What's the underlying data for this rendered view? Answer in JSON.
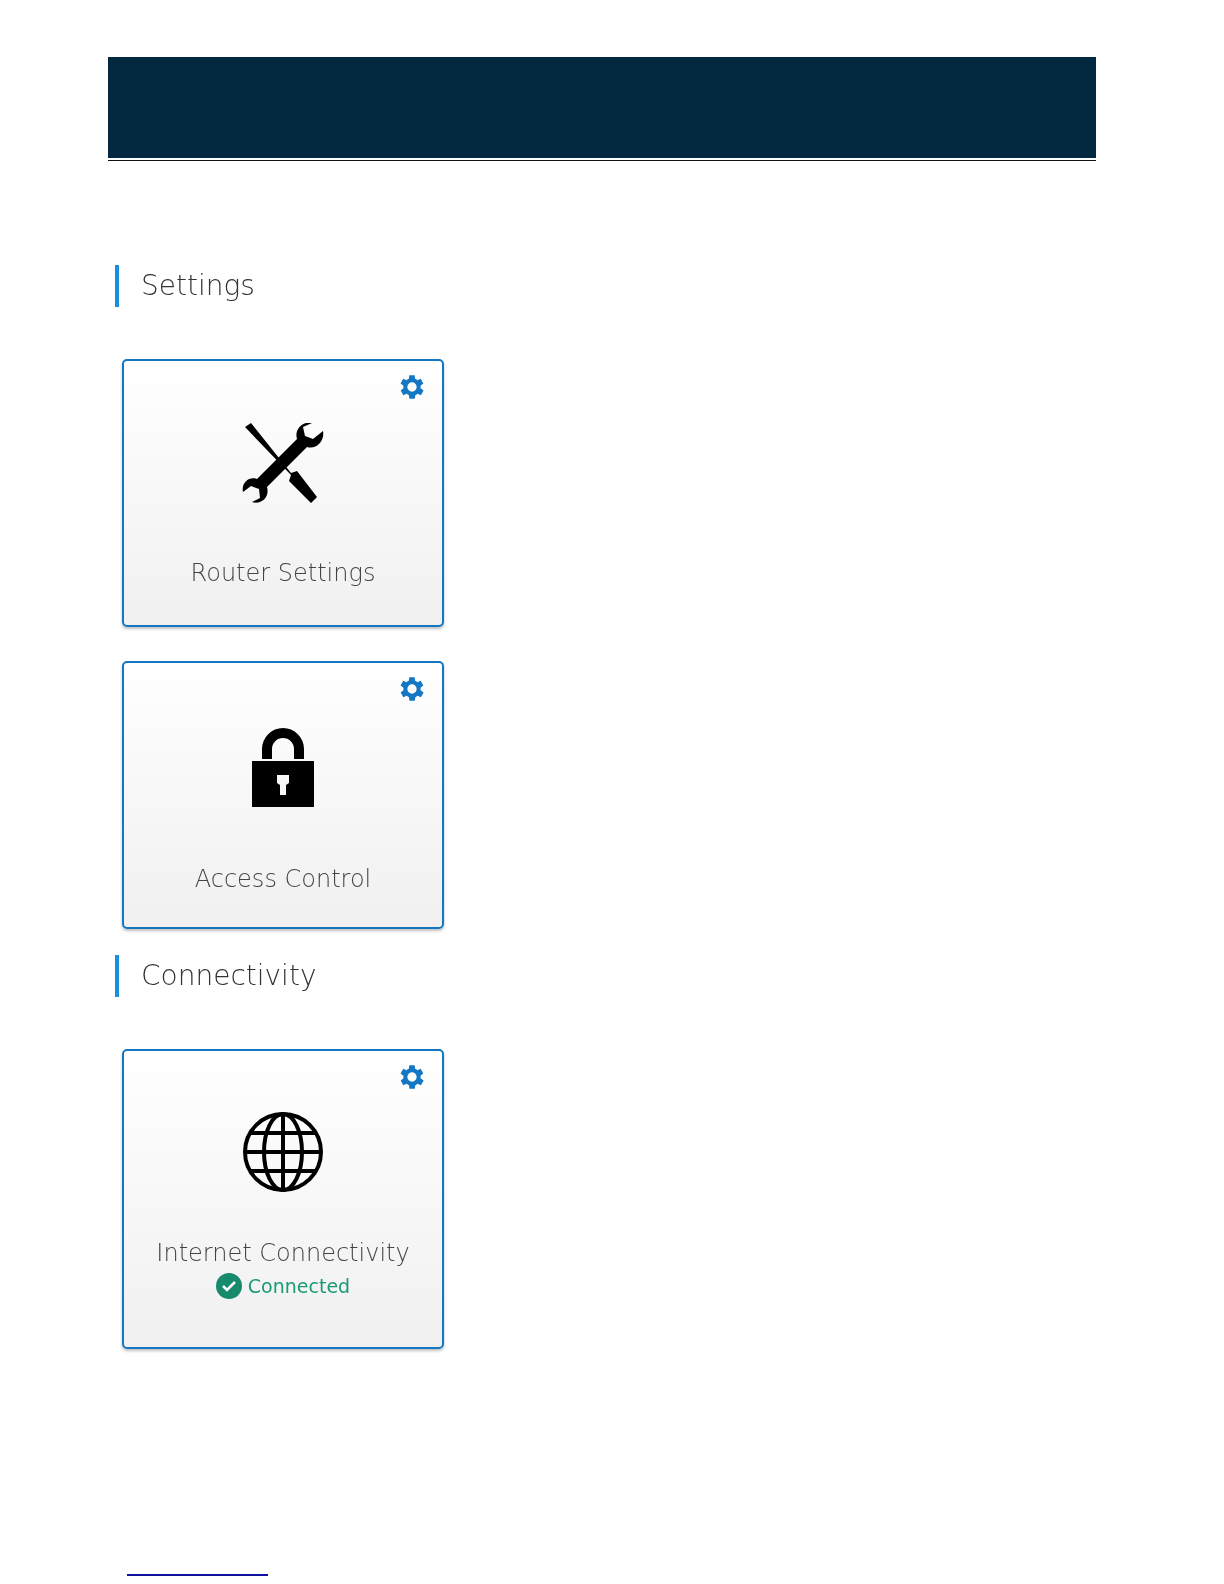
{
  "sections": [
    {
      "title": "Settings",
      "tiles": [
        {
          "kind": "tools",
          "label": "Router Settings"
        },
        {
          "kind": "lock",
          "label": "Access Control"
        }
      ]
    },
    {
      "title": "Connectivity",
      "tiles": [
        {
          "kind": "globe",
          "label": "Internet Connectivity",
          "status": {
            "kind": "ok",
            "text": "Connected"
          }
        }
      ]
    }
  ]
}
